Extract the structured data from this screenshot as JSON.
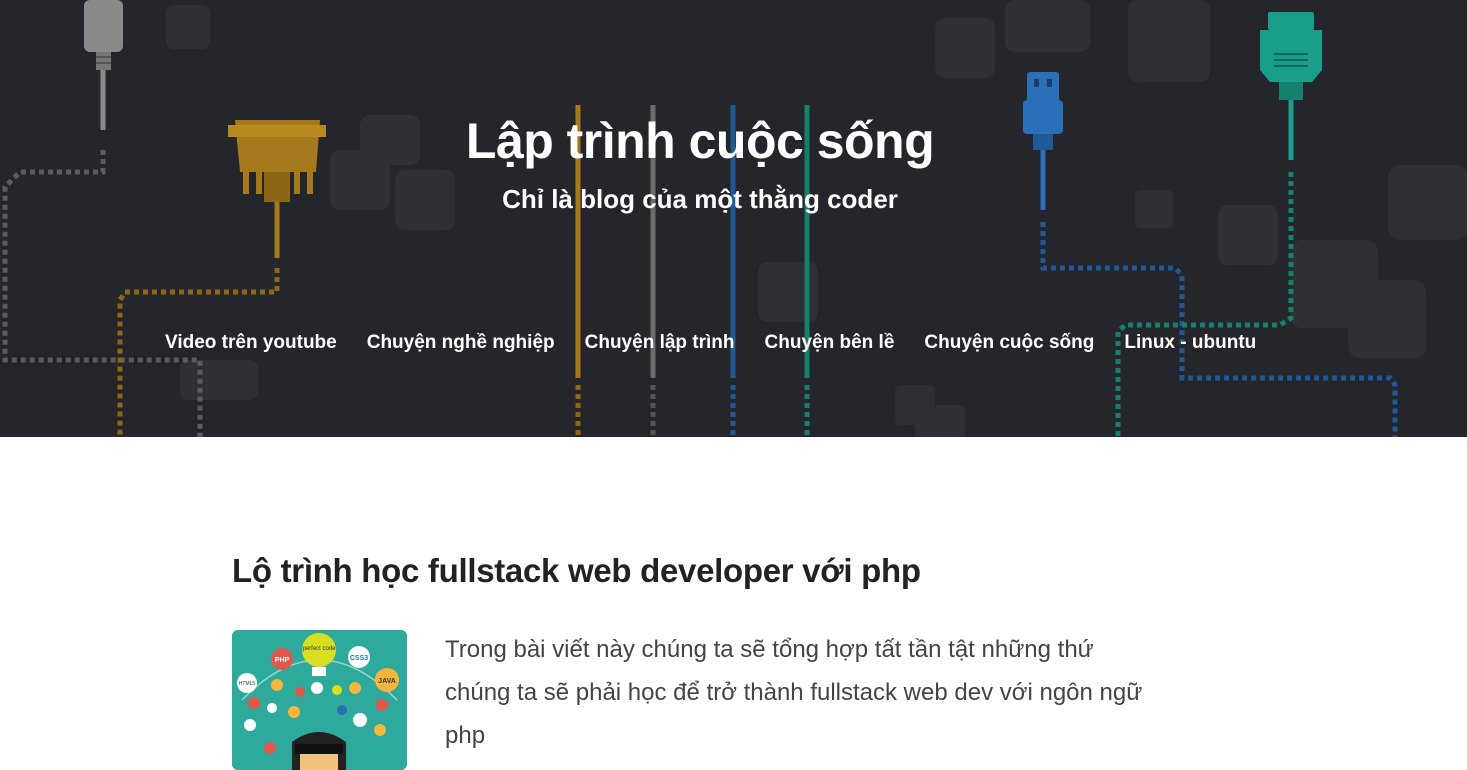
{
  "site": {
    "title": "Lập trình cuộc sống",
    "tagline": "Chỉ là blog của một thằng coder"
  },
  "nav": {
    "items": [
      {
        "label": "Video trên youtube"
      },
      {
        "label": "Chuyện nghề nghiệp"
      },
      {
        "label": "Chuyện lập trình"
      },
      {
        "label": "Chuyện bên lề"
      },
      {
        "label": "Chuyện cuộc sống"
      },
      {
        "label": "Linux - ubuntu"
      }
    ]
  },
  "post": {
    "title": "Lộ trình học fullstack web developer với php",
    "excerpt": "Trong bài viết này chúng ta sẽ tổng hợp tất tần tật những thứ chúng ta sẽ phải học để trở thành fullstack web dev với ngôn ngữ php",
    "thumbnail": {
      "labels": [
        "perfect code",
        "PHP",
        "CSS3",
        "HTML5",
        "JAVA"
      ],
      "accent": "#2eaa9c"
    }
  },
  "colors": {
    "hero_bg": "#25262b",
    "cable_gray": "#8a8a8a",
    "cable_gold": "#b8860b",
    "cable_blue": "#2a6fb8",
    "cable_teal": "#1a9e8c"
  }
}
